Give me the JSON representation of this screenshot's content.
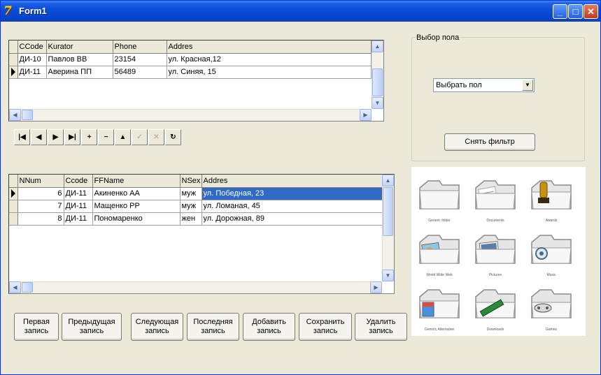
{
  "window": {
    "title": "Form1",
    "buttons": {
      "minimize": "_",
      "maximize": "□",
      "close": "✕"
    }
  },
  "grid_top": {
    "columns": [
      "CCode",
      "Kurator",
      "Phone",
      "Addres"
    ],
    "rows": [
      {
        "ccode": "ДИ-10",
        "kurator": "Павлов ВВ",
        "phone": "23154",
        "addres": "ул. Красная,12"
      },
      {
        "ccode": "ДИ-11",
        "kurator": "Аверина ПП",
        "phone": "56489",
        "addres": "ул. Синяя, 15"
      }
    ]
  },
  "grid_bottom": {
    "columns": [
      "NNum",
      "Ccode",
      "FFName",
      "NSex",
      "Addres"
    ],
    "rows": [
      {
        "nnum": "6",
        "ccode": "ДИ-11",
        "ffname": "Акиненко АА",
        "nsex": "муж",
        "addres": "ул. Победная, 23"
      },
      {
        "nnum": "7",
        "ccode": "ДИ-11",
        "ffname": "Мащенко РР",
        "nsex": "муж",
        "addres": "ул. Ломаная, 45"
      },
      {
        "nnum": "8",
        "ccode": "ДИ-11",
        "ffname": "Пономаренко",
        "nsex": "жен",
        "addres": "ул. Дорожная, 89"
      }
    ]
  },
  "navigator": {
    "first": "|◀",
    "prior": "◀",
    "next": "▶",
    "last": "▶|",
    "insert": "+",
    "delete": "−",
    "edit": "▲",
    "post": "✓",
    "cancel": "✕",
    "refresh": "↻"
  },
  "filter": {
    "group_label": "Выбор пола",
    "combo_value": "Выбрать пол",
    "clear_button": "Снять фильтр"
  },
  "buttons": {
    "first": "Первая запись",
    "prev": "Предыдущая запись",
    "next": "Следующая запись",
    "last": "Последняя запись",
    "add": "Добавить запись",
    "save": "Сохранить запись",
    "delete": "Удалить запись"
  },
  "folders": [
    {
      "caption": "Generic folder",
      "icon": "blank"
    },
    {
      "caption": "Documents",
      "icon": "document"
    },
    {
      "caption": "Awards",
      "icon": "trophy"
    },
    {
      "caption": "World Wide Web",
      "icon": "globe"
    },
    {
      "caption": "Pictures",
      "icon": "photo"
    },
    {
      "caption": "Music",
      "icon": "music"
    },
    {
      "caption": "Generic Alternative",
      "icon": "box"
    },
    {
      "caption": "Downloads",
      "icon": "download"
    },
    {
      "caption": "Games",
      "icon": "gamepad"
    }
  ]
}
